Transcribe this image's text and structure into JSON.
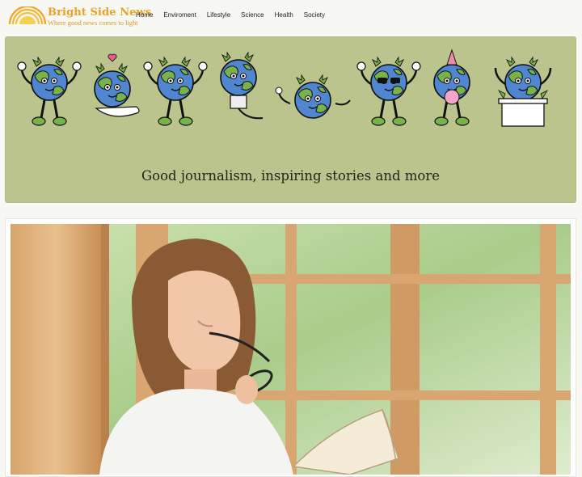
{
  "brand": {
    "title": "Bright Side News",
    "tagline": "Where good news comes to light"
  },
  "nav": {
    "items": [
      "Home",
      "Enviroment",
      "Lifestyle",
      "Science",
      "Health",
      "Society"
    ]
  },
  "hero": {
    "heading": "Good journalism, inspiring stories and more",
    "illustration": "cartoon-earth-characters"
  },
  "feature": {
    "image": "woman-reading-book-by-window"
  },
  "colors": {
    "brand": "#e8a420",
    "hero_bg": "#bcc48e",
    "page_bg": "#f7f7f3"
  }
}
